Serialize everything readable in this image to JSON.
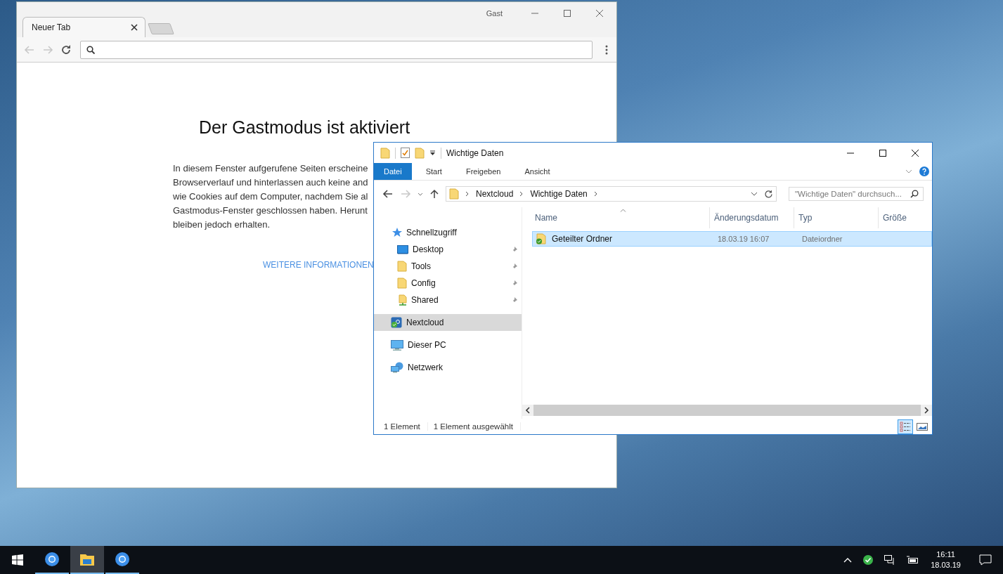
{
  "browser": {
    "profile": "Gast",
    "tabs": [
      {
        "label": "Neuer Tab",
        "selected": true
      }
    ],
    "nav_buttons": [
      {
        "kind": "back",
        "disabled": true
      },
      {
        "kind": "forward",
        "disabled": true
      }
    ],
    "page": {
      "heading": "Der Gastmodus ist aktiviert",
      "lines": [
        "In diesem Fenster aufgerufene Seiten erscheine",
        "Browserverlauf und hinterlassen auch keine and",
        "wie Cookies auf dem Computer, nachdem Sie al",
        "Gastmodus-Fenster geschlossen haben. Herunt",
        "bleiben jedoch erhalten."
      ],
      "link": "WEITERE INFORMATIONEN"
    }
  },
  "explorer": {
    "title": "Wichtige Daten",
    "ribbon_tabs": [
      {
        "label": "Datei",
        "selected": true
      },
      {
        "label": "Start",
        "selected": false
      },
      {
        "label": "Freigeben",
        "selected": false
      },
      {
        "label": "Ansicht",
        "selected": false
      }
    ],
    "nav_buttons": [
      {
        "kind": "back",
        "disabled": false
      },
      {
        "kind": "forward",
        "disabled": true
      }
    ],
    "breadcrumb": [
      "Nextcloud",
      "Wichtige Daten"
    ],
    "search": {
      "placeholder": "\"Wichtige Daten\" durchsuch..."
    },
    "nav": [
      {
        "label": "Schnellzugriff",
        "kind": "star",
        "selected": false,
        "children": [
          {
            "label": "Desktop",
            "kind": "desktop",
            "selected": false,
            "pinned": true
          },
          {
            "label": "Tools",
            "kind": "folder",
            "selected": false,
            "pinned": true
          },
          {
            "label": "Config",
            "kind": "folder",
            "selected": false,
            "pinned": true
          },
          {
            "label": "Shared",
            "kind": "shared",
            "selected": false,
            "pinned": true
          }
        ]
      },
      {
        "label": "Nextcloud",
        "kind": "cloud",
        "selected": true
      },
      {
        "label": "Dieser PC",
        "kind": "pc",
        "selected": false
      },
      {
        "label": "Netzwerk",
        "kind": "network",
        "selected": false
      }
    ],
    "columns": [
      {
        "label": "Name",
        "sorted": true
      },
      {
        "label": "Änderungsdatum",
        "sorted": false
      },
      {
        "label": "Typ",
        "sorted": false
      },
      {
        "label": "Größe",
        "sorted": false
      }
    ],
    "rows": [
      {
        "cells": [
          "Geteilter Ordner",
          "18.03.19 16:07",
          "Dateiordner"
        ],
        "selected": true
      }
    ],
    "status": [
      "1 Element",
      "1 Element ausgewählt"
    ],
    "view_buttons": [
      {
        "kind": "details",
        "selected": true
      },
      {
        "kind": "tiles",
        "selected": false
      }
    ]
  },
  "taskbar": {
    "apps": [
      {
        "kind": "chrome",
        "selected": false
      },
      {
        "kind": "explorer",
        "selected": true
      },
      {
        "kind": "chrome",
        "selected": false
      }
    ],
    "time": "16:11",
    "date": "18.03.19"
  }
}
